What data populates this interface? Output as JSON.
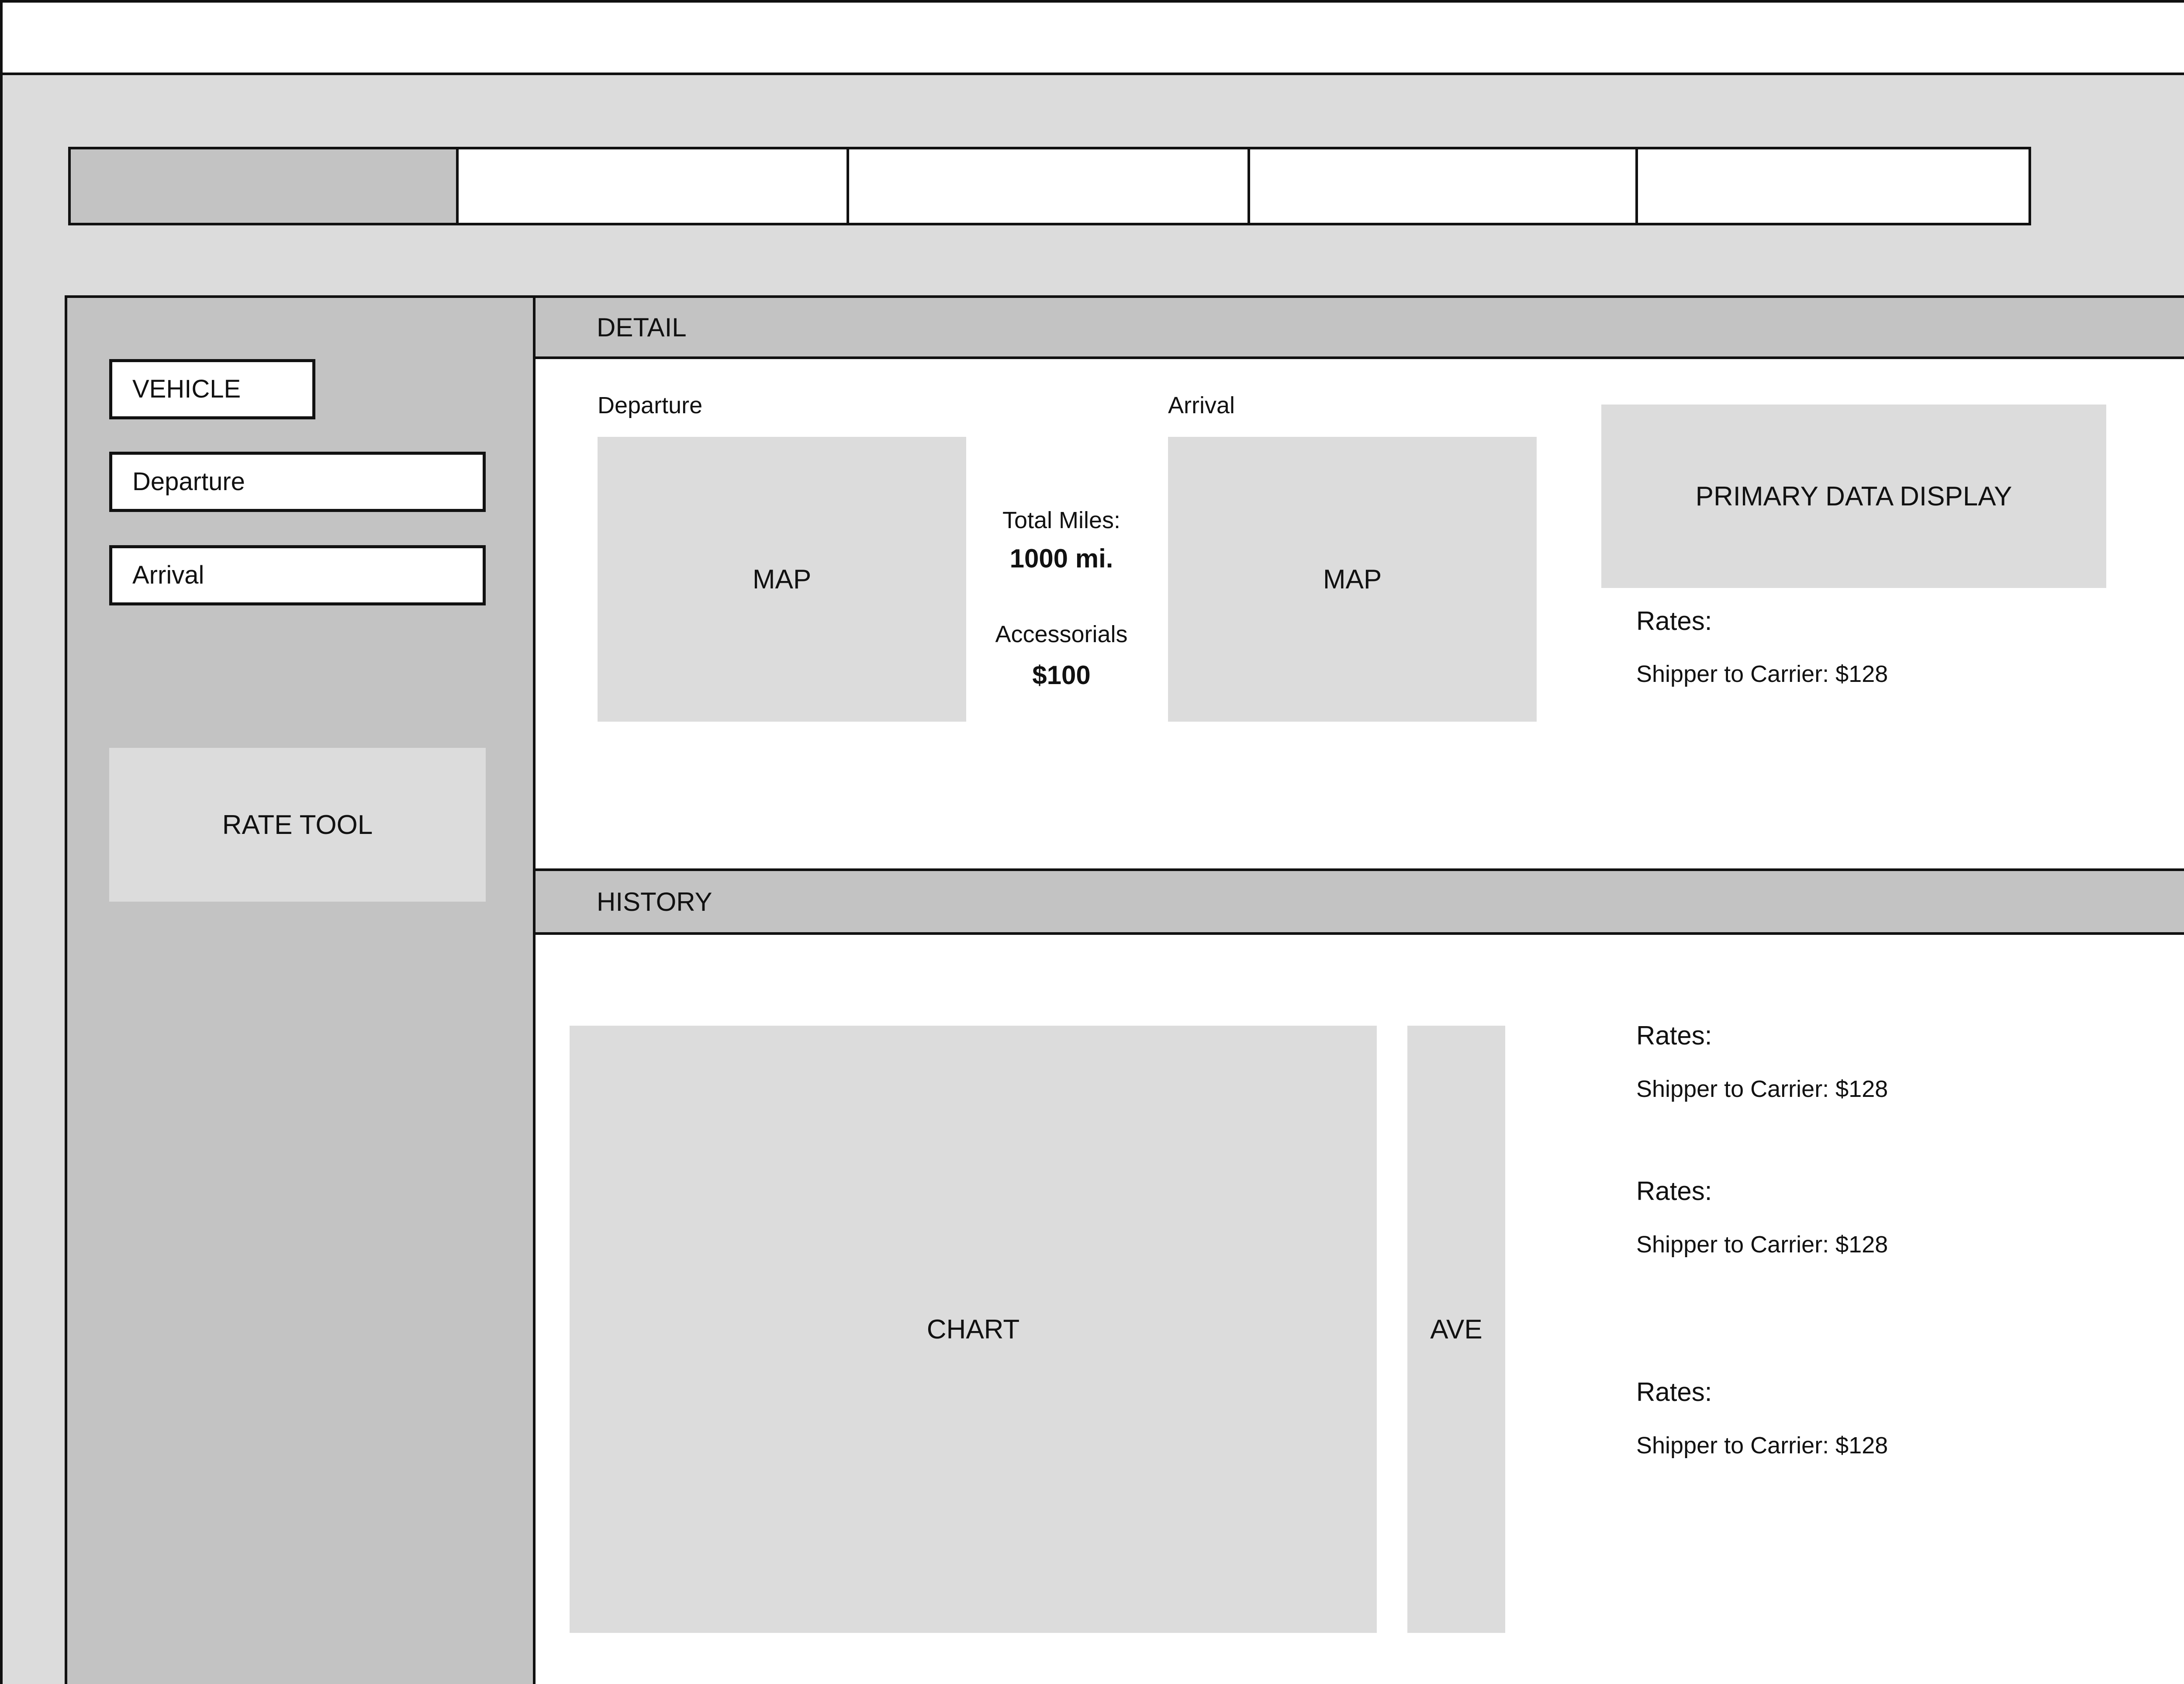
{
  "tabs": [
    "",
    "",
    "",
    "",
    ""
  ],
  "sidebar": {
    "vehicle": "VEHICLE",
    "departure": "Departure",
    "arrival": "Arrival",
    "rate_tool": "RATE TOOL"
  },
  "detail": {
    "header": "DETAIL",
    "departure_label": "Departure",
    "arrival_label": "Arrival",
    "departure_map": "MAP",
    "arrival_map": "MAP",
    "total_miles_label": "Total Miles:",
    "total_miles_value": "1000 mi.",
    "accessorials_label": "Accessorials",
    "accessorials_value": "$100",
    "primary_display": "PRIMARY DATA DISPLAY",
    "rates_label": "Rates:",
    "rates_value": "Shipper to Carrier: $128"
  },
  "history": {
    "header": "HISTORY",
    "chart": "CHART",
    "ave": "AVE",
    "rates": [
      {
        "label": "Rates:",
        "value": "Shipper to Carrier: $128"
      },
      {
        "label": "Rates:",
        "value": "Shipper to Carrier: $128"
      },
      {
        "label": "Rates:",
        "value": "Shipper to Carrier: $128"
      }
    ]
  }
}
